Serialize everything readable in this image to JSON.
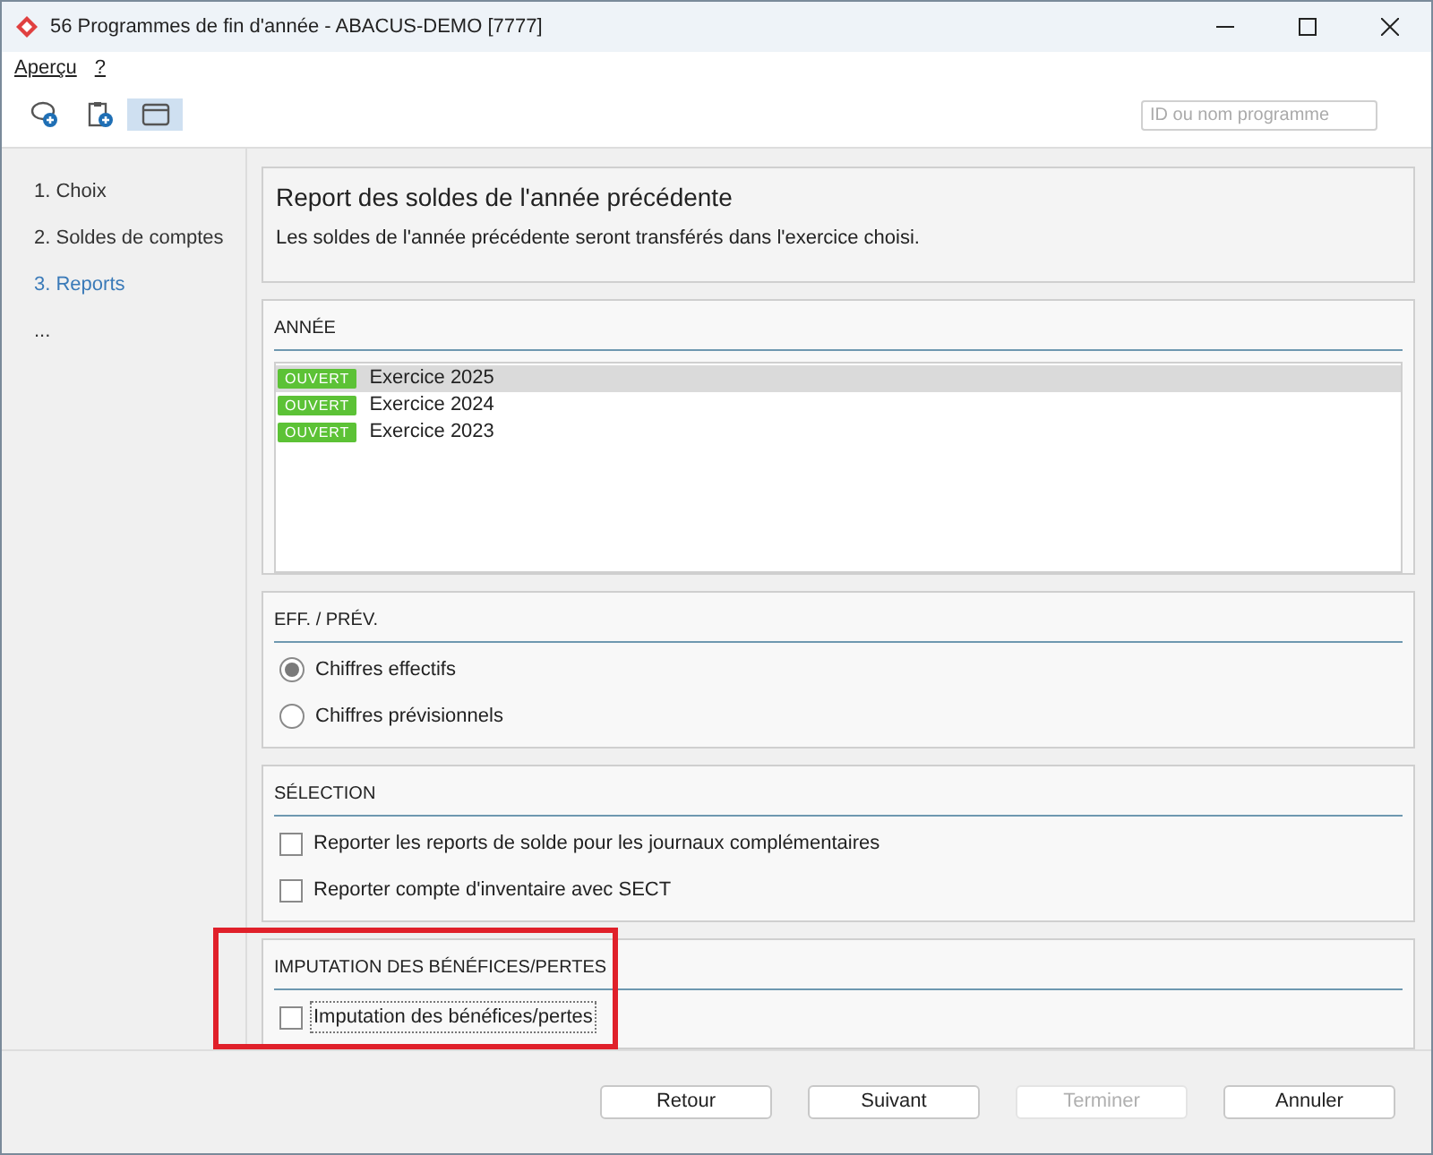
{
  "window": {
    "title": "56 Programmes de fin d'année - ABACUS-DEMO [7777]"
  },
  "menu": [
    {
      "label": "Aperçu"
    },
    {
      "label": "?"
    }
  ],
  "toolbar": [
    {
      "kind": "chat",
      "selected": false
    },
    {
      "kind": "clipboard",
      "selected": false
    },
    {
      "kind": "window",
      "selected": true
    }
  ],
  "search": {
    "placeholder": "ID ou nom programme"
  },
  "steps": [
    {
      "label": "1. Choix",
      "selected": false
    },
    {
      "label": "2. Soldes de comptes",
      "selected": false
    },
    {
      "label": "3. Reports",
      "selected": true
    },
    {
      "label": "...",
      "selected": false
    }
  ],
  "header": {
    "title": "Report des soldes de l'année précédente",
    "description": "Les soldes de l'année précédente seront transférés dans l'exercice choisi."
  },
  "year_section": {
    "title": "ANNÉE",
    "items": [
      {
        "badge": "OUVERT",
        "label": "Exercice 2025",
        "selected": true
      },
      {
        "badge": "OUVERT",
        "label": "Exercice 2024",
        "selected": false
      },
      {
        "badge": "OUVERT",
        "label": "Exercice 2023",
        "selected": false
      }
    ]
  },
  "sections": [
    {
      "title": "EFF. / PRÉV.",
      "highlighted": false,
      "options": [
        {
          "kind": "radio",
          "label": "Chiffres effectifs",
          "checked": true
        },
        {
          "kind": "radio",
          "label": "Chiffres prévisionnels",
          "checked": false
        }
      ]
    },
    {
      "title": "SÉLECTION",
      "highlighted": false,
      "options": [
        {
          "kind": "checkbox",
          "label": "Reporter les reports de solde pour les journaux complémentaires",
          "checked": false
        },
        {
          "kind": "checkbox",
          "label": "Reporter compte d'inventaire avec SECT",
          "checked": false
        }
      ]
    },
    {
      "title": "IMPUTATION DES BÉNÉFICES/PERTES",
      "highlighted": true,
      "options": [
        {
          "kind": "checkbox",
          "label": "Imputation des bénéfices/pertes",
          "checked": false,
          "focused": true
        }
      ]
    }
  ],
  "buttons": [
    {
      "label": "Retour",
      "disabled": false
    },
    {
      "label": "Suivant",
      "disabled": false
    },
    {
      "label": "Terminer",
      "disabled": true
    },
    {
      "label": "Annuler",
      "disabled": false
    }
  ]
}
